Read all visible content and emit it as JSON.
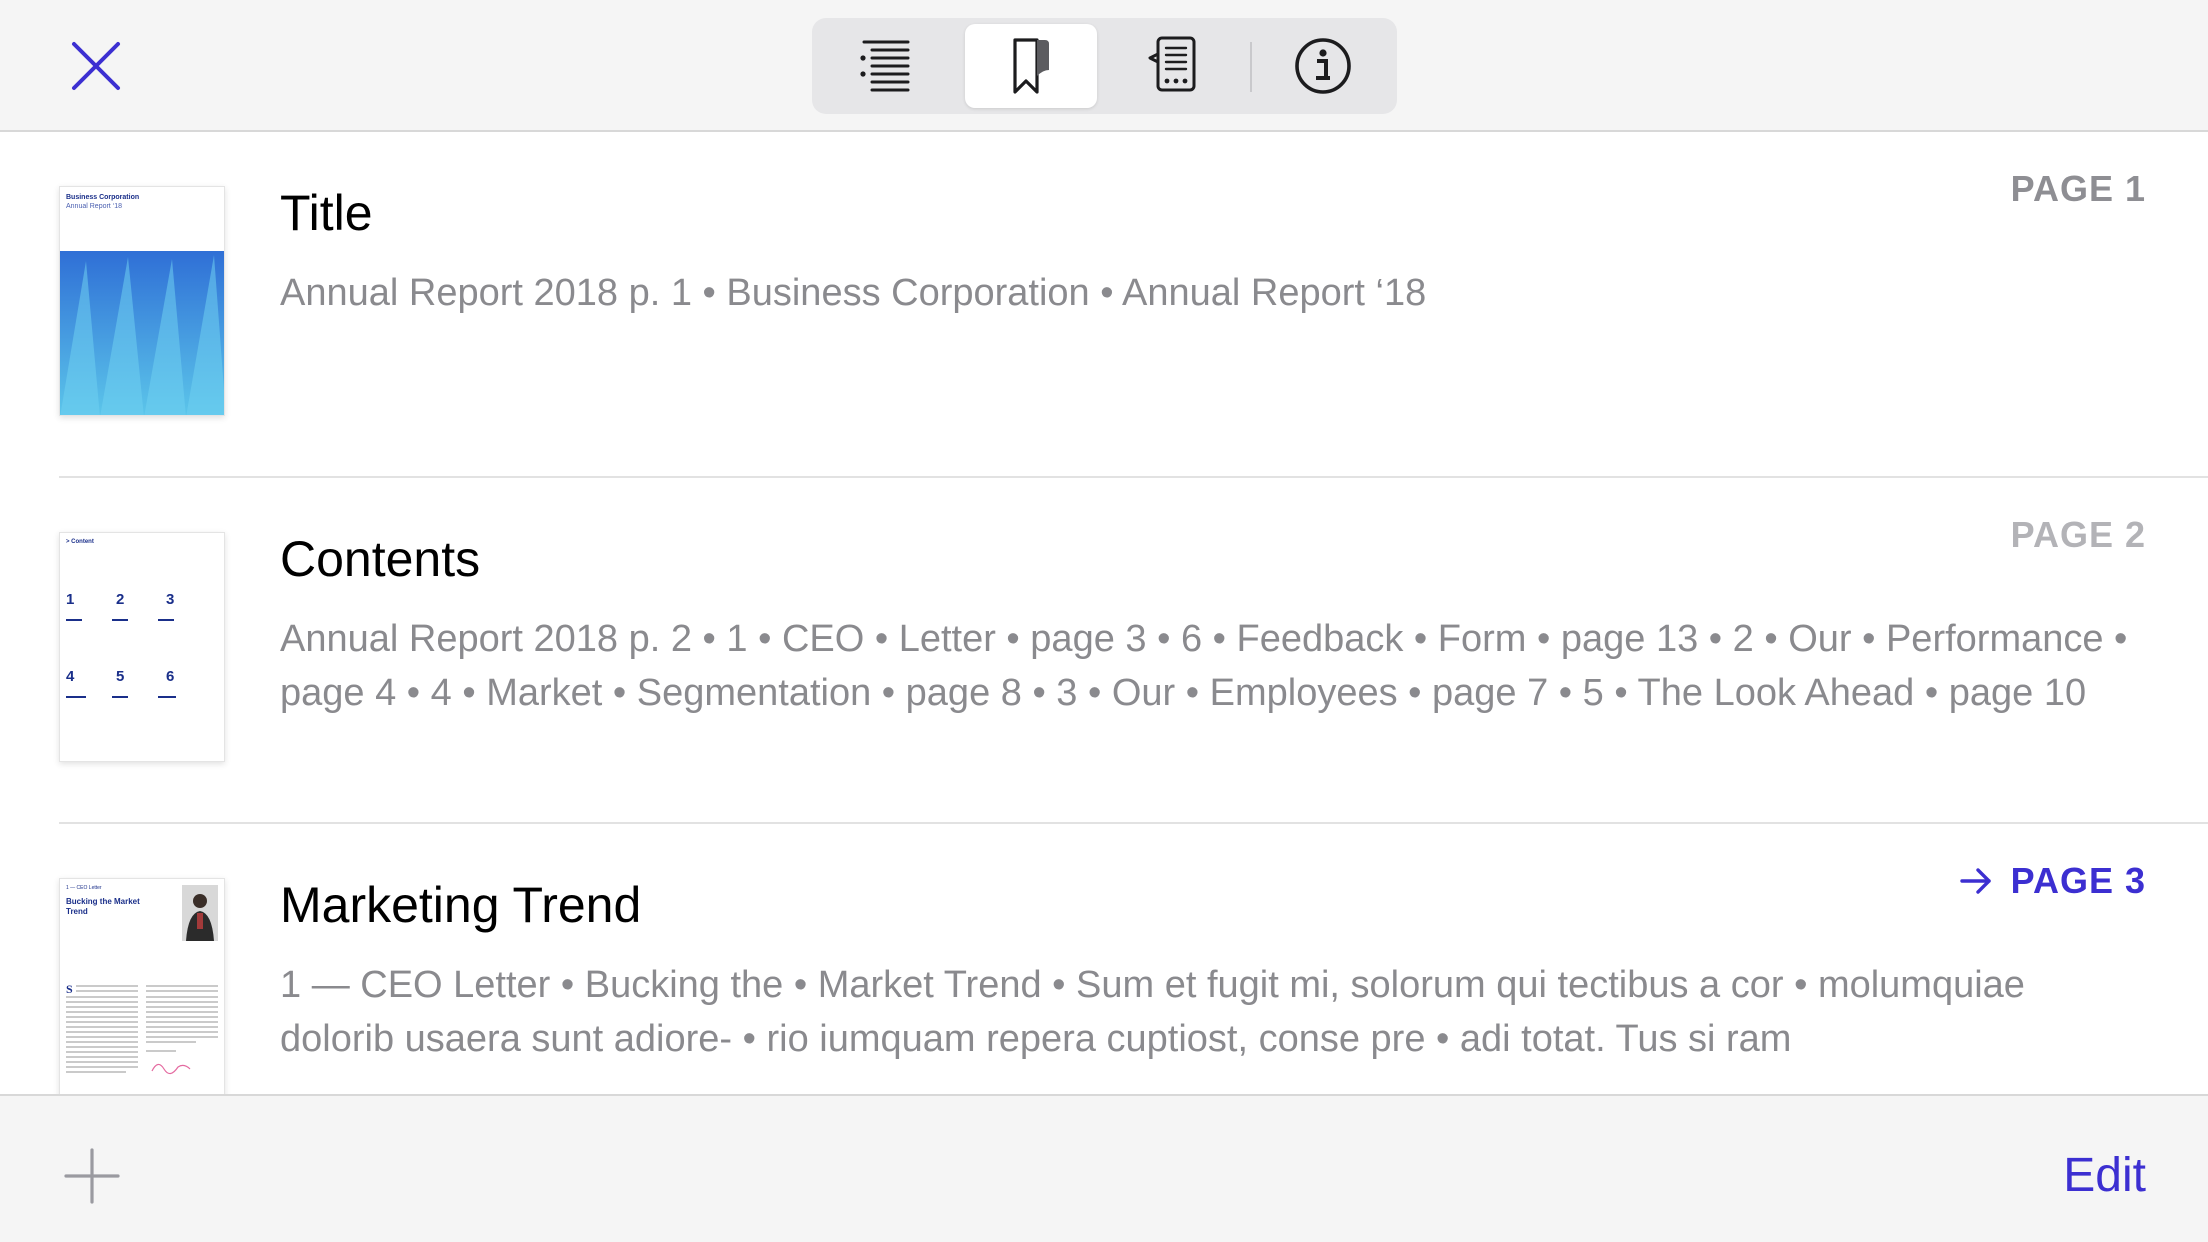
{
  "toolbar": {
    "close_icon": "close-icon",
    "tabs": [
      {
        "icon": "table-of-contents-icon",
        "active": false
      },
      {
        "icon": "bookmark-icon",
        "active": true
      },
      {
        "icon": "annotations-icon",
        "active": false
      },
      {
        "icon": "info-icon",
        "active": false
      }
    ]
  },
  "bookmarks": [
    {
      "title": "Title",
      "description": "Annual Report 2018 p. 1 • Business Corporation • Annual Report ‘18",
      "page_label": "PAGE 1",
      "state": "normal",
      "thumbnail": {
        "line1": "Business Corporation",
        "line2": "Annual Report ‘18"
      }
    },
    {
      "title": "Contents",
      "description": "Annual Report 2018 p. 2 • 1 • CEO • Letter • page 3 • 6 • Feedback • Form • page 13 • 2 • Our • Performance • page 4 • 4 • Market • Segmentation • page 8 • 3 • Our • Employees • page 7 • 5 • The Look Ahead • page 10",
      "page_label": "PAGE 2",
      "state": "faint",
      "thumbnail": {
        "header": "Content",
        "numbers": [
          "1",
          "2",
          "3",
          "4",
          "5",
          "6"
        ]
      }
    },
    {
      "title": "Marketing Trend",
      "description": "1 — CEO Letter • Bucking the • Market Trend • Sum et fugit mi, solorum qui tectibus a cor • molumquiae dolorib usaera sunt adiore- • rio iumquam repera cuptiost, conse pre • adi totat. Tus si ram",
      "page_label": "PAGE 3",
      "state": "current",
      "thumbnail": {
        "header": "1 — CEO Letter",
        "heading": "Bucking the Market Trend"
      }
    }
  ],
  "bottom": {
    "add_icon": "plus-icon",
    "edit_label": "Edit"
  },
  "colors": {
    "accent": "#3c2fd1",
    "secondary_text": "#8a8a8e",
    "bar_background": "#f5f5f5"
  }
}
